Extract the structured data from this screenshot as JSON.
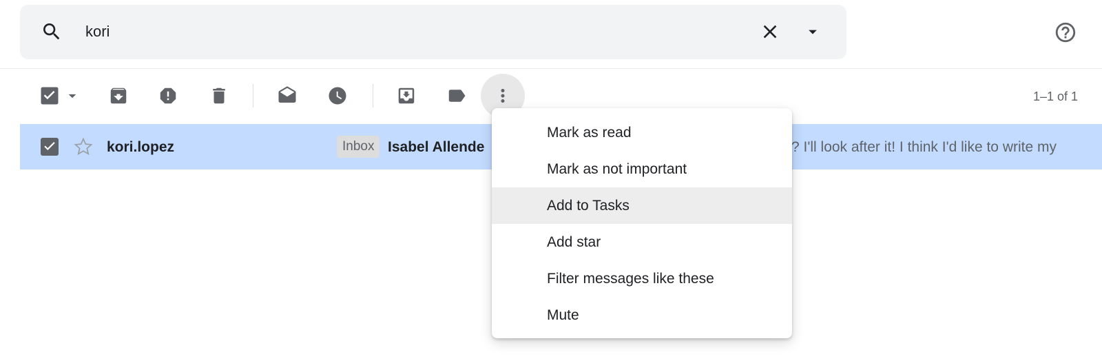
{
  "search": {
    "query": "kori"
  },
  "toolbar": {
    "pager_text": "1–1 of 1"
  },
  "thread": {
    "sender": "kori.lopez",
    "label": "Inbox",
    "subject": "Isabel Allende",
    "snippet": "? I'll look after it! I think I'd like to write my",
    "selected": true,
    "starred": false
  },
  "more_menu": {
    "items": [
      {
        "label": "Mark as read"
      },
      {
        "label": "Mark as not important"
      },
      {
        "label": "Add to Tasks",
        "hovered": true
      },
      {
        "label": "Add star"
      },
      {
        "label": "Filter messages like these"
      },
      {
        "label": "Mute"
      }
    ]
  },
  "colors": {
    "selected_row": "#c2dbff",
    "search_bg": "#f1f3f4",
    "icon": "#5f6368"
  },
  "icons": [
    "search-icon",
    "close-icon",
    "chevron-down-icon",
    "help-icon",
    "checkbox-icon",
    "archive-icon",
    "report-spam-icon",
    "delete-icon",
    "mark-as-read-icon",
    "snooze-icon",
    "move-to-inbox-icon",
    "label-icon",
    "more-vert-icon",
    "star-icon"
  ]
}
